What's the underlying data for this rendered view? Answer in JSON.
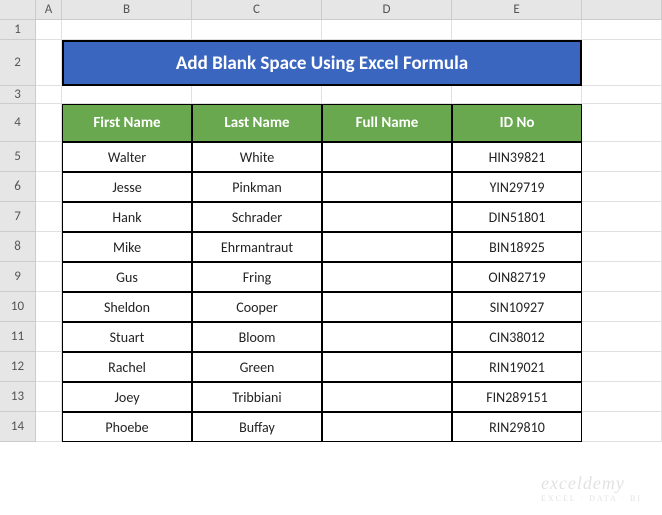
{
  "columns": [
    "A",
    "B",
    "C",
    "D",
    "E"
  ],
  "row_numbers": [
    1,
    2,
    3,
    4,
    5,
    6,
    7,
    8,
    9,
    10,
    11,
    12,
    13,
    14
  ],
  "title": "Add Blank Space Using Excel Formula",
  "headers": {
    "b": "First Name",
    "c": "Last Name",
    "d": "Full Name",
    "e": "ID No"
  },
  "rows": [
    {
      "first": "Walter",
      "last": "White",
      "full": "",
      "id": "HIN39821"
    },
    {
      "first": "Jesse",
      "last": "Pinkman",
      "full": "",
      "id": "YIN29719"
    },
    {
      "first": "Hank",
      "last": "Schrader",
      "full": "",
      "id": "DIN51801"
    },
    {
      "first": "Mike",
      "last": "Ehrmantraut",
      "full": "",
      "id": "BIN18925"
    },
    {
      "first": "Gus",
      "last": "Fring",
      "full": "",
      "id": "OIN82719"
    },
    {
      "first": "Sheldon",
      "last": "Cooper",
      "full": "",
      "id": "SIN10927"
    },
    {
      "first": "Stuart",
      "last": "Bloom",
      "full": "",
      "id": "CIN38012"
    },
    {
      "first": "Rachel",
      "last": "Green",
      "full": "",
      "id": "RIN19021"
    },
    {
      "first": "Joey",
      "last": "Tribbiani",
      "full": "",
      "id": "FIN289151"
    },
    {
      "first": "Phoebe",
      "last": "Buffay",
      "full": "",
      "id": "RIN29810"
    }
  ],
  "watermark": {
    "main": "exceldemy",
    "sub": "EXCEL · DATA · BI"
  }
}
